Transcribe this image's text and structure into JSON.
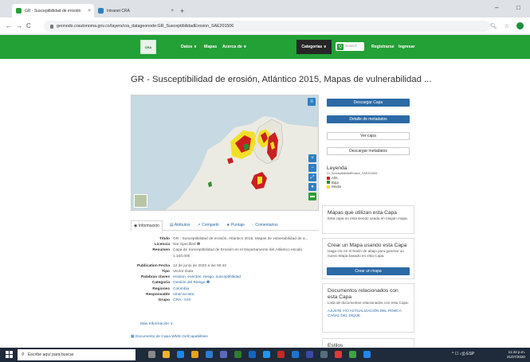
{
  "browser": {
    "tabs": [
      {
        "title": "GR - Susceptibilidad de erosión",
        "active": true,
        "favicon_color": "#23a036"
      },
      {
        "title": "Intranet CRA",
        "active": false,
        "favicon_color": "#2e7fc5"
      }
    ],
    "new_tab": "+",
    "close": "×",
    "url": "geonodo.crautonoma.gov.co/layers/cra_datageonode:GR_SusceptibilidadErosion_SAE201506",
    "window_controls": {
      "minimize": "–",
      "maximize": "□"
    }
  },
  "site": {
    "logo_text": "CRA",
    "nav": [
      "Datos ∨",
      "Mapas",
      "Acerca de ∨"
    ],
    "categories_label": "Categorías ∨",
    "search_placeholder": "Search",
    "register": "Registrarse",
    "login": "Ingresar"
  },
  "page": {
    "title": "GR - Susceptibilidad de erosión, Atlántico 2015, Mapas de vulnerabilidad ...",
    "map_controls": [
      "+",
      "−",
      "⤢",
      "●",
      "▬"
    ],
    "tabs": [
      "Información",
      "Atributos",
      "Compartir",
      "Puntaje",
      "Comentarios"
    ],
    "tab_icons": [
      "◉",
      "▤",
      "↗",
      "★",
      "◌"
    ],
    "info": [
      {
        "k": "Título",
        "v": "GR - Susceptibilidad de erosión, Atlántico 2015, Mapas de vulnerabilidad de a...",
        "link": false
      },
      {
        "k": "Licencia",
        "v": "Not Specified ❶",
        "link": false
      },
      {
        "k": "Resumen",
        "v": "Capa de Susceptibilidad de Erosión en el Departamento del Atlántico escala 1:100.000",
        "link": false
      },
      {
        "k": "",
        "v": "",
        "gap": true
      },
      {
        "k": "Publication Fecha",
        "v": "12 de junio de 2020 a las 00:43",
        "link": false
      },
      {
        "k": "Tipo",
        "v": "Vector Data",
        "link": false
      },
      {
        "k": "Palabras claves",
        "v": "erosion, eventos, riesgo, susceptibilidad",
        "link": true
      },
      {
        "k": "Categoría",
        "v": "Gestión del Riesgo ❶",
        "link": true
      },
      {
        "k": "Regiones",
        "v": "Colombia",
        "link": true
      },
      {
        "k": "Responsable",
        "v": "omar.acosta",
        "link": true
      },
      {
        "k": "Grupo",
        "v": "CRA - GIS",
        "link": true
      }
    ],
    "more_info": "Más Información ∨",
    "documents_link": "Documento de Capa WMS GetCapabilities"
  },
  "sidebar": {
    "download_layer": "Descargar Capa",
    "metadata_detail": "Detalle de metadatos",
    "view_layer": "Ver capa",
    "download_metadata": "Descargar metadatos",
    "legend_title": "Leyenda",
    "legend_subtitle": "GI_SusceptibilidadErosion_SAE201506",
    "legend_items": [
      {
        "label": "Alta",
        "color": "#cc1f1f"
      },
      {
        "label": "Baja",
        "color": "#2e8b2e"
      },
      {
        "label": "Media",
        "color": "#f2e024"
      }
    ],
    "maps_using_title": "Mapas que utilizan esta Capa",
    "maps_using_text": "Esta capa no esta siendo usada en ningún mapa.",
    "create_map_title": "Crear un Mapa usando esta Capa",
    "create_map_text": "Haga clic en el botón de abajo para generar un nuevo Mapa basado en esta Capa.",
    "create_map_button": "Crear un mapa",
    "related_docs_title": "Documentos relacionados con esta Capa",
    "related_docs_text": "Lista de documentos relacionados con esta Capa:",
    "related_doc_link": "AJUSTE Y/O ACTUALIZACIÓN DEL POMCA CAÑAL DEL DIQUE",
    "styles_title": "Estilos"
  },
  "taskbar": {
    "search_placeholder": "Escribe aquí para buscar",
    "icons": [
      "#8a8a8a",
      "#f0b429",
      "#1e88e5",
      "#e8a317",
      "#2b7cd3",
      "#5c6bc0",
      "#2e7d32",
      "#1565c0",
      "#2196f3",
      "#c62828",
      "#1976d2",
      "#3949ab",
      "#546e7a",
      "#e53935",
      "#43a047",
      "#1e88e5"
    ],
    "tray_text": "^ ☐ ◁)) ESP",
    "time": "11:42 p.m.",
    "date": "21/07/2020"
  }
}
